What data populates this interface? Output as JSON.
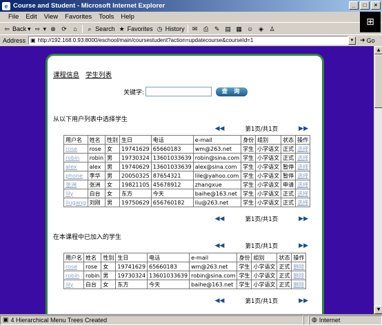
{
  "window": {
    "title": "Course and Student - Microsoft Internet Explorer"
  },
  "menu": [
    "File",
    "Edit",
    "View",
    "Favorites",
    "Tools",
    "Help"
  ],
  "toolbar": {
    "back": "Back",
    "search": "Search",
    "favorites": "Favorites",
    "history": "History"
  },
  "address": {
    "label": "Address",
    "url": "http://192.168.0.93:8000/eschool/main/coursestudent?action=updatecourse&courseId=1",
    "go": "Go"
  },
  "page": {
    "nav": [
      "课程信息",
      "学生列表"
    ],
    "search_label": "关键字:",
    "search_value": "",
    "search_button": "查 询",
    "section1_title": "从以下用户列表中选择学生",
    "section2_title": "在本课程中已加入的学生",
    "pager1": "第1页/共1页",
    "pager2": "第1页/共1页",
    "pager3": "第1页/共1页",
    "columns": [
      "用户名",
      "姓名",
      "性别",
      "生日",
      "电话",
      "e-mail",
      "身份",
      "组别",
      "状态",
      "操作"
    ],
    "users": [
      [
        "rose",
        "rose",
        "女",
        "19741629",
        "65660183",
        "wm@263.net",
        "学生",
        "小学语文",
        "正式",
        "选择"
      ],
      [
        "robin",
        "robin",
        "男",
        "19730324",
        "13601033639",
        "robin@sina.com",
        "学生",
        "小学语文",
        "正式",
        "选择"
      ],
      [
        "alex",
        "alex",
        "男",
        "19740629",
        "13601033639",
        "alex@sina.com",
        "学生",
        "小学语文",
        "暂停",
        "选择"
      ],
      [
        "phone",
        "李华",
        "男",
        "20050325",
        "87654321",
        "lile@yahoo.com",
        "学生",
        "小学语文",
        "暂停",
        "选择"
      ],
      [
        "张洲",
        "张洲",
        "女",
        "19821105",
        "45678912",
        "zhangxue",
        "学生",
        "小学语文",
        "申请",
        "选择"
      ],
      [
        "lily",
        "白台",
        "女",
        "东方",
        "今天",
        "baihe@163.net",
        "学生",
        "小学语文",
        "正式",
        "选择"
      ],
      [
        "liugang",
        "刘刚",
        "男",
        "19750629",
        "656760182",
        "liu@263.net",
        "学生",
        "小学语文",
        "正式",
        "选择"
      ]
    ],
    "enrolled": [
      [
        "rose",
        "rose",
        "女",
        "19741629",
        "65660183",
        "wm@263.net",
        "学生",
        "小学语文",
        "正式",
        "删除"
      ],
      [
        "robin",
        "robin",
        "男",
        "19730324",
        "13601033639",
        "robin@sina.com",
        "学生",
        "小学语文",
        "正式",
        "删除"
      ],
      [
        "lily",
        "白台",
        "女",
        "东方",
        "今天",
        "baihe@163.net",
        "学生",
        "小学语文",
        "正式",
        "删除"
      ]
    ]
  },
  "status": {
    "text": "4 Hierarchical Menu Trees Created",
    "zone": "Internet"
  },
  "colors": {
    "page_bg": "#3a0ca3",
    "panel_border": "#2f8a3a",
    "link_faint": "#8aa0c0"
  }
}
